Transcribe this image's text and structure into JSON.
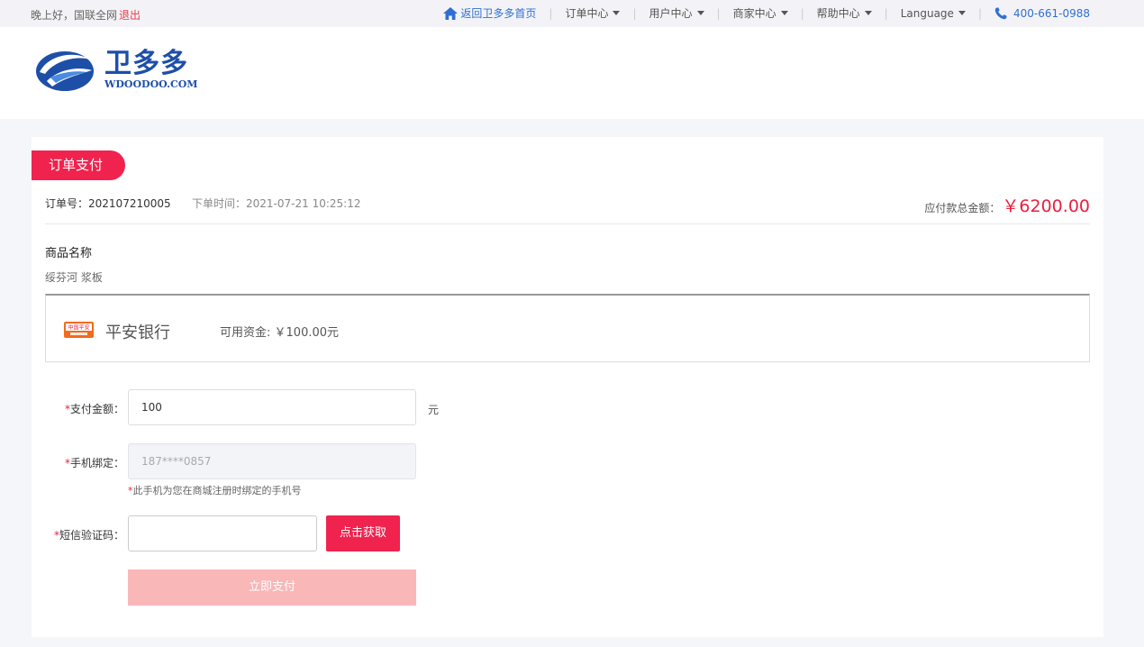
{
  "topbar": {
    "greeting": "晚上好，国联全网",
    "logout": "退出",
    "nav": {
      "home": "返回卫多多首页",
      "orders": "订单中心",
      "user": "用户中心",
      "merchant": "商家中心",
      "help": "帮助中心",
      "language": "Language",
      "phone": "400-661-0988"
    },
    "separator": "|"
  },
  "header": {
    "logo_cn": "卫多多",
    "logo_en": "WDOODOO.COM"
  },
  "order": {
    "badge": "订单支付",
    "number_label": "订单号：",
    "number": "202107210005",
    "time_label": "下单时间：",
    "time": "2021-07-21 10:25:12",
    "total_label": "应付款总金额：",
    "total_amount": "￥6200.00",
    "product_title": "商品名称",
    "product_name": "绥芬河 浆板"
  },
  "bank": {
    "logo_text": "中国平安",
    "name": "平安银行",
    "funds_label": "可用资金:",
    "funds_value": "￥100.00元"
  },
  "form": {
    "required_mark": "*",
    "amount_label": "支付金额：",
    "amount_value": "100",
    "amount_unit": "元",
    "phone_label": "手机绑定：",
    "phone_value": "187****0857",
    "phone_hint": "此手机为您在商城注册时绑定的手机号",
    "sms_label": "短信验证码：",
    "sms_value": "",
    "sms_button": "点击获取",
    "pay_button": "立即支付"
  },
  "colors": {
    "accent": "#f0234e",
    "link": "#2f6fd4",
    "pay_disabled": "#f9b7b8"
  }
}
